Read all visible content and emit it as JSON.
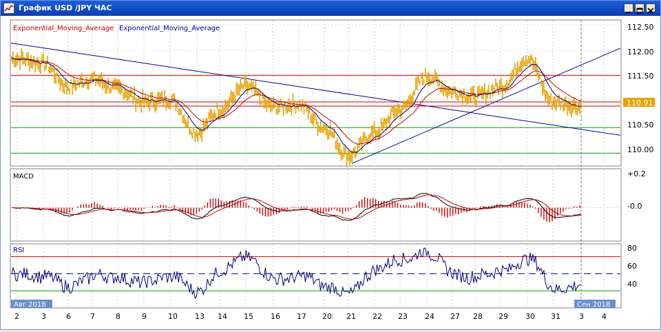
{
  "window": {
    "title": "График USD /JPY ЧАС",
    "icon": "chart-icon",
    "buttons": [
      "minimize-icon",
      "maximize-icon",
      "close-icon"
    ]
  },
  "price_panel": {
    "legend": [
      {
        "text": "Exponential_Moving_Average",
        "color": "#cc0000"
      },
      {
        "text": "Exponential_Moving_Average",
        "color": "#000099"
      }
    ],
    "y_ticks": [
      "112.50",
      "112.00",
      "111.50",
      "111.00",
      "110.50",
      "110.00"
    ],
    "current_price": "110.91",
    "current_price_value": 110.91,
    "colors": {
      "price": "#e8a000",
      "ema_slow": "#cc0000",
      "ema_fast": "#000080",
      "resistance": "#cc0000",
      "support": "#00aa00",
      "trend": "#000099"
    }
  },
  "macd_panel": {
    "label": "MACD",
    "y_ticks": [
      "+0.2",
      "-0.0"
    ]
  },
  "rsi_panel": {
    "label": "RSI",
    "y_ticks": [
      "80",
      "60",
      "40"
    ],
    "levels": {
      "overbought": 70,
      "middle": 50,
      "oversold": 30
    }
  },
  "x_axis": {
    "ticks": [
      "2",
      "3",
      "6",
      "7",
      "8",
      "9",
      "10",
      "13",
      "14",
      "15",
      "16",
      "17",
      "20",
      "21",
      "22",
      "23",
      "24",
      "27",
      "28",
      "29",
      "30",
      "31",
      "3",
      "4"
    ],
    "month_start": "Авг 2018",
    "month_end": "Сен 2018"
  },
  "chart_data": {
    "type": "line",
    "instrument": "USD /JPY",
    "timeframe": "ЧАС",
    "price_range": [
      109.75,
      112.6
    ],
    "horizontal_lines": {
      "resistance": [
        111.52,
        111.0,
        110.92
      ],
      "support": [
        110.5,
        110.0
      ]
    },
    "price_keypoints": {
      "x": [
        "2",
        "3",
        "6",
        "7",
        "8",
        "9",
        "10",
        "13",
        "14",
        "15",
        "16",
        "17",
        "20",
        "21",
        "22",
        "23",
        "24",
        "27",
        "28",
        "29",
        "30",
        "31",
        "3"
      ],
      "y": [
        111.85,
        111.75,
        111.3,
        111.45,
        111.25,
        111.0,
        111.05,
        110.4,
        110.85,
        111.3,
        110.9,
        110.95,
        110.5,
        109.95,
        110.4,
        110.85,
        111.5,
        111.2,
        111.1,
        111.3,
        111.85,
        111.0,
        110.91
      ]
    }
  }
}
